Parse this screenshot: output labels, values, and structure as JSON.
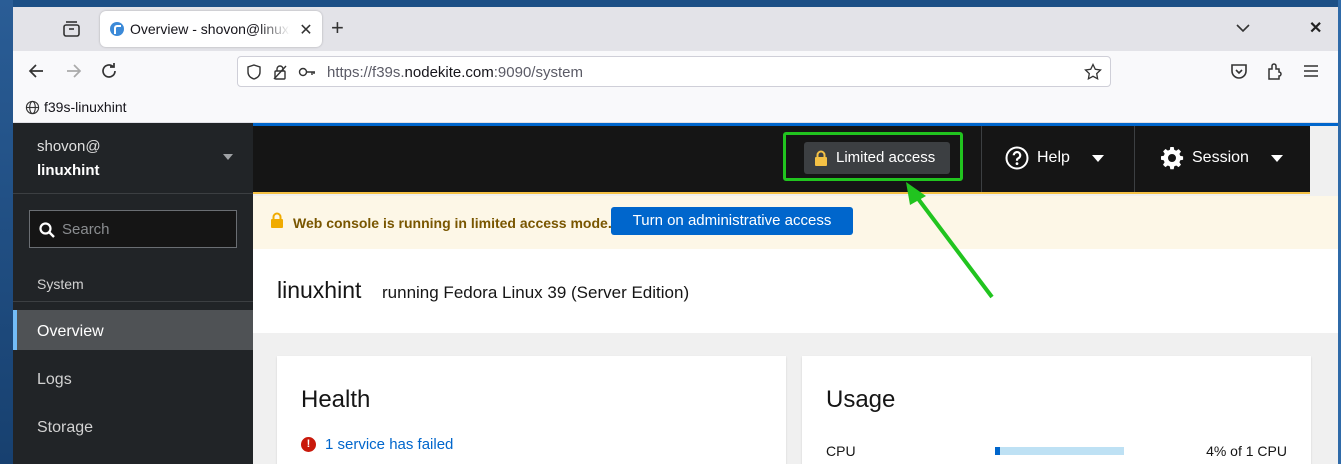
{
  "browser": {
    "tab_title": "Overview - shovon@linuxhint",
    "tab_close": "✕",
    "new_tab": "+",
    "window_close": "✕",
    "url_prefix": "https://f39s.",
    "url_domain": "nodekite.com",
    "url_suffix": ":9090/system",
    "bookmark": "f39s-linuxhint"
  },
  "sidebar": {
    "user": "shovon@",
    "host": "linuxhint",
    "search_placeholder": "Search",
    "section": "System",
    "items": [
      {
        "label": "Overview",
        "active": true
      },
      {
        "label": "Logs",
        "active": false
      },
      {
        "label": "Storage",
        "active": false
      }
    ]
  },
  "masthead": {
    "limited_access": "Limited access",
    "help": "Help",
    "session": "Session"
  },
  "alert": {
    "message": "Web console is running in limited access mode.",
    "button": "Turn on administrative access"
  },
  "page": {
    "hostname": "linuxhint",
    "running": "running Fedora Linux 39 (Server Edition)"
  },
  "health": {
    "title": "Health",
    "item": "1 service has failed"
  },
  "usage": {
    "title": "Usage",
    "cpu_label": "CPU",
    "cpu_value": "4% of 1 CPU",
    "cpu_fraction": 0.04
  },
  "colors": {
    "accent": "#0066cc",
    "highlight": "#21c41f",
    "warning": "#f4c145",
    "danger": "#c9190b"
  }
}
